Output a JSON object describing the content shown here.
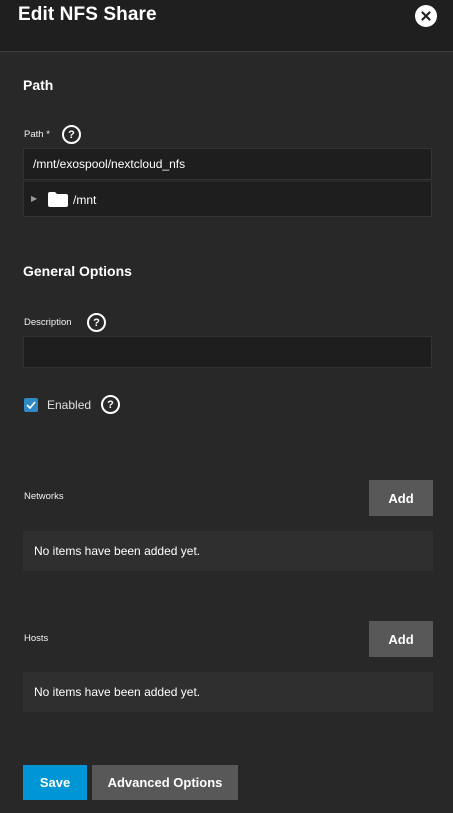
{
  "header": {
    "title": "Edit NFS Share"
  },
  "path_section": {
    "title": "Path",
    "path_label": "Path",
    "required_mark": "*",
    "path_value": "/mnt/exospool/nextcloud_nfs",
    "tree_root": "/mnt"
  },
  "general": {
    "title": "General Options",
    "description_label": "Description",
    "description_value": "",
    "enabled_label": "Enabled",
    "enabled": true
  },
  "networks": {
    "label": "Networks",
    "add_label": "Add",
    "empty_text": "No items have been added yet."
  },
  "hosts": {
    "label": "Hosts",
    "add_label": "Add",
    "empty_text": "No items have been added yet."
  },
  "actions": {
    "save_label": "Save",
    "advanced_label": "Advanced Options"
  },
  "icons": {
    "close": "close-icon",
    "help": "help-icon",
    "folder": "folder-icon",
    "check": "check-icon"
  },
  "colors": {
    "accent": "#0095d5",
    "checkbox": "#2e89c4",
    "button_gray": "#585858",
    "background": "#282828"
  }
}
